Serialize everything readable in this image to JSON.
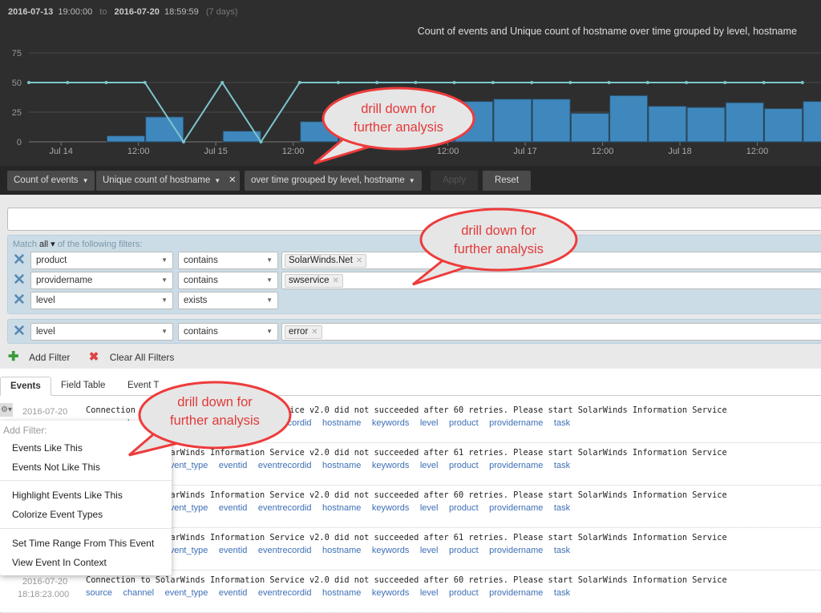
{
  "header": {
    "range_start_date": "2016-07-13",
    "range_start_time": "19:00:00",
    "range_to": "to",
    "range_end_date": "2016-07-20",
    "range_end_time": "18:59:59",
    "range_duration": "(7 days)"
  },
  "chart_data": {
    "type": "bar+line",
    "title": "Count of events and Unique count of hostname over time grouped by level, hostname",
    "ylim": [
      0,
      80
    ],
    "yticks": [
      0,
      25,
      50,
      75
    ],
    "xticks": [
      {
        "t": "2016-07-14 00:00",
        "label": "Jul 14"
      },
      {
        "t": "2016-07-14 12:00",
        "label": "12:00"
      },
      {
        "t": "2016-07-15 00:00",
        "label": "Jul 15"
      },
      {
        "t": "2016-07-15 12:00",
        "label": "12:00"
      },
      {
        "t": "2016-07-16 12:00",
        "label": "12:00"
      },
      {
        "t": "2016-07-17 00:00",
        "label": "Jul 17"
      },
      {
        "t": "2016-07-17 12:00",
        "label": "12:00"
      },
      {
        "t": "2016-07-18 00:00",
        "label": "Jul 18"
      },
      {
        "t": "2016-07-18 12:00",
        "label": "12:00"
      }
    ],
    "x": [
      "2016-07-13 19:00",
      "2016-07-14 01:00",
      "2016-07-14 07:00",
      "2016-07-14 13:00",
      "2016-07-14 19:00",
      "2016-07-15 01:00",
      "2016-07-15 07:00",
      "2016-07-15 13:00",
      "2016-07-15 19:00",
      "2016-07-16 01:00",
      "2016-07-16 07:00",
      "2016-07-16 13:00",
      "2016-07-16 19:00",
      "2016-07-17 01:00",
      "2016-07-17 07:00",
      "2016-07-17 13:00",
      "2016-07-17 19:00",
      "2016-07-18 01:00",
      "2016-07-18 07:00",
      "2016-07-18 13:00",
      "2016-07-18 19:00"
    ],
    "series": [
      {
        "kind": "bar",
        "color": "#3f88bd",
        "values": [
          0,
          0,
          5,
          21,
          0,
          9,
          0,
          17,
          28,
          30,
          32,
          34,
          36,
          36,
          24,
          39,
          30,
          29,
          33,
          28,
          34
        ]
      },
      {
        "kind": "line",
        "color": "#7cc6cc",
        "values": [
          50,
          50,
          50,
          50,
          0,
          50,
          0,
          50,
          50,
          50,
          50,
          50,
          50,
          50,
          50,
          50,
          50,
          50,
          50,
          50,
          50
        ]
      }
    ],
    "grid": true
  },
  "toolbar": {
    "metric1": "Count of events",
    "metric2": "Unique count of hostname",
    "remove": "✕",
    "grouping": "over time grouped by level, hostname",
    "apply": "Apply",
    "reset": "Reset"
  },
  "filters": {
    "search_value": "",
    "match_prefix": "Match",
    "match_mode": "all",
    "match_suffix": "of the following filters:",
    "group1": [
      {
        "field": "product",
        "op": "contains",
        "value": "SolarWinds.Net"
      },
      {
        "field": "providername",
        "op": "contains",
        "value": "swservice"
      },
      {
        "field": "level",
        "op": "exists",
        "value": ""
      }
    ],
    "group2": [
      {
        "field": "level",
        "op": "contains",
        "value": "error"
      }
    ],
    "add_filter": "Add Filter",
    "clear_all": "Clear All Filters"
  },
  "tabs": [
    "Events",
    "Field Table",
    "Event T"
  ],
  "events": [
    {
      "date": "2016-07-20",
      "time": "",
      "msg": "Connection to SolarWinds Information Service v2.0 did not succeeded after 60 retries. Please start SolarWinds Information Service"
    },
    {
      "date": "",
      "time": "",
      "msg": "Connection to SolarWinds Information Service v2.0 did not succeeded after 61 retries. Please start SolarWinds Information Service"
    },
    {
      "date": "",
      "time": "",
      "msg": "Connection to SolarWinds Information Service v2.0 did not succeeded after 60 retries. Please start SolarWinds Information Service"
    },
    {
      "date": "",
      "time": "",
      "msg": "Connection to SolarWinds Information Service v2.0 did not succeeded after 61 retries. Please start SolarWinds Information Service"
    },
    {
      "date": "2016-07-20",
      "time": "18:18:23.000",
      "msg": "Connection to SolarWinds Information Service v2.0 did not succeeded after 60 retries. Please start SolarWinds Information Service"
    }
  ],
  "event_fields": [
    "source",
    "channel",
    "event_type",
    "eventid",
    "eventrecordid",
    "hostname",
    "keywords",
    "level",
    "product",
    "providername",
    "task"
  ],
  "context_menu": {
    "header": "Add Filter:",
    "items": [
      "Events Like This",
      "Events Not Like This",
      "Highlight Events Like This",
      "Colorize Event Types",
      "Set Time Range From This Event",
      "View Event In Context"
    ]
  },
  "callouts": [
    "drill down for\nfurther analysis",
    "drill down for\nfurther analysis",
    "drill down for\nfurther analysis"
  ]
}
